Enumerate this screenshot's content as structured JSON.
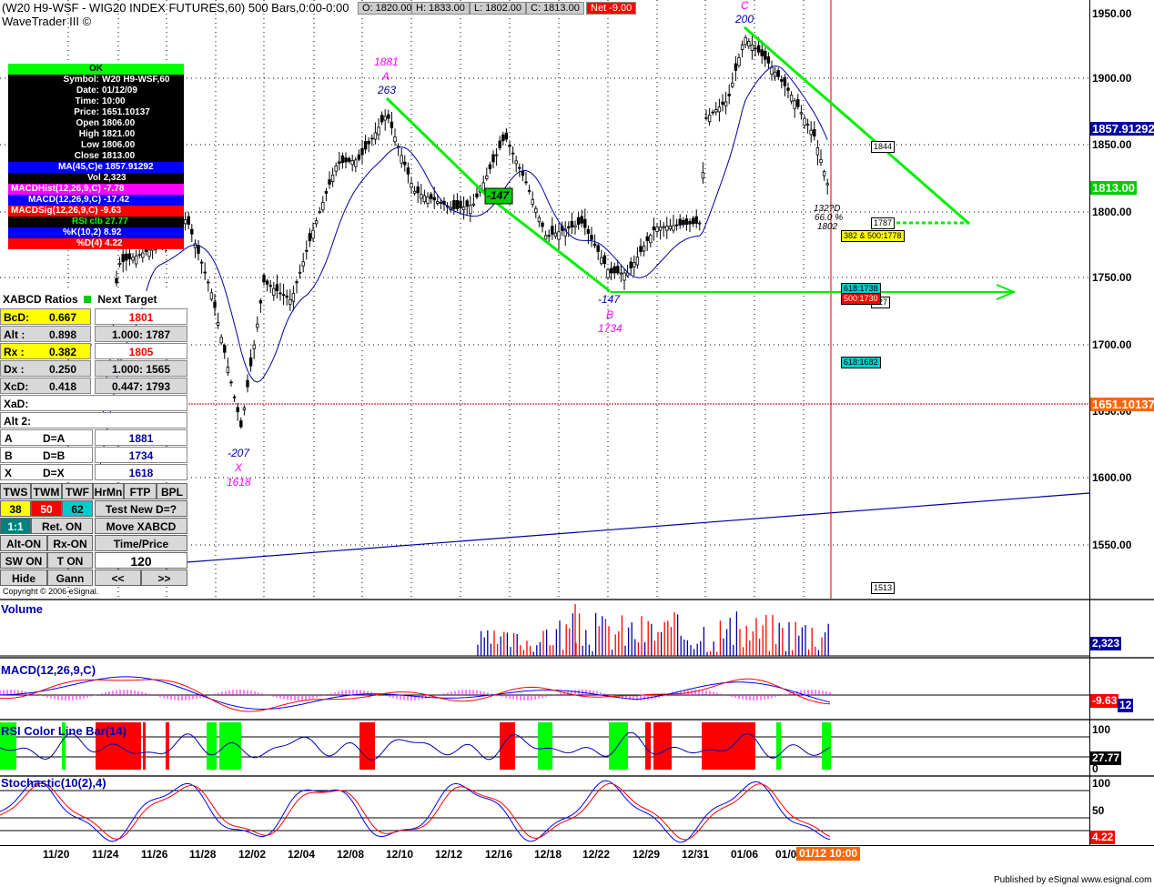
{
  "header": {
    "title_line1": "(W20 H9-WSF - WIG20 INDEX FUTURES,60) 500 Bars,0:00-0:00",
    "title_line2": "WaveTrader III ©",
    "open": "O: 1820.00",
    "high": "H: 1833.00",
    "low": "L: 1802.00",
    "close": "C: 1813.00",
    "net": "Net -9.00"
  },
  "info_panel": {
    "status": "OK",
    "rows": [
      {
        "k": "Symbol:",
        "v": "W20 H9-WSF,60"
      },
      {
        "k": "Date:",
        "v": "01/12/09"
      },
      {
        "k": "Time:",
        "v": "10:00"
      },
      {
        "k": "Price:",
        "v": "1651.10137"
      },
      {
        "k": "Open",
        "v": "1806.00"
      },
      {
        "k": "High",
        "v": "1821.00"
      },
      {
        "k": "Low",
        "v": "1806.00"
      },
      {
        "k": "Close",
        "v": "1813.00"
      }
    ],
    "ma": "MA(45,C)e  1857.91292",
    "vol": "Vol  2,323",
    "macdhist": "MACDHist(12,26,9,C) -7.78",
    "macd": "MACD(12,26,9,C) -17.42",
    "macdsig": "MACDSig(12,26,9,C) -9.63",
    "rsi": "RSI clb  27.77",
    "k": "%K(10,2)  8.92",
    "d": "%D(4)  4.22"
  },
  "xabcd": {
    "title": "XABCD Ratios",
    "next_target": "Next Target",
    "rows": [
      {
        "label": "BcD:",
        "val": "0.667",
        "target": "1801"
      },
      {
        "label": "Alt  :",
        "val": "0.898",
        "target": "1.000: 1787"
      },
      {
        "label": "Rx   :",
        "val": "0.382",
        "target": "1805"
      },
      {
        "label": "Dx   :",
        "val": "0.250",
        "target": "1.000: 1565"
      },
      {
        "label": "XcD:",
        "val": "0.418",
        "target": "0.447: 1793"
      }
    ],
    "xad": "XaD:",
    "alt2": "Alt 2:",
    "eq_rows": [
      {
        "label": "A",
        "eq": "D=A",
        "val": "1881"
      },
      {
        "label": "B",
        "eq": "D=B",
        "val": "1734"
      },
      {
        "label": "X",
        "eq": "D=X",
        "val": "1618"
      }
    ],
    "buttons_row1": [
      "TWS",
      "TWM",
      "TWF",
      "HrMn",
      "FTP",
      "BPL"
    ],
    "num1": "38",
    "num2": "50",
    "num3": "62",
    "test_new": "Test New D=?",
    "ratio": "1:1",
    "ret_on": "Ret. ON",
    "move_xabcd": "Move XABCD",
    "alt_on": "Alt-ON",
    "rx_on": "Rx-ON",
    "time_price": "Time/Price",
    "sw_on": "SW ON",
    "t_on": "T ON",
    "bars": "120",
    "hide": "Hide",
    "gann": "Gann",
    "prev": "<<",
    "next": ">>"
  },
  "pattern_labels": {
    "x_bars": "-207",
    "x_name": "X",
    "x_price": "1618",
    "a_price": "1881",
    "a_name": "A",
    "a_bars": "263",
    "b_bars": "-147",
    "b_name": "B",
    "b_price": "1734",
    "c_name": "C",
    "c_bars": "200",
    "d_ratio": "132?D",
    "d_pct": "66.0 %",
    "d_price": "1802",
    "mid_bars": "-147"
  },
  "target_boxes": {
    "t1844": "1844",
    "t1787": "1787",
    "t382": "382 & 500:1778",
    "t618": "618:1738",
    "t500": "500:1730",
    "t727": "727",
    "t618b": "618:1682",
    "t1513": "1513"
  },
  "price_axis": {
    "ticks": [
      "1950.00",
      "1900.00",
      "1850.00",
      "1800.00",
      "1750.00",
      "1700.00",
      "1650.00",
      "1600.00",
      "1550.00"
    ],
    "ma_tag": "1857.91292",
    "close_tag": "1813.00",
    "cursor_tag": "1651.10137"
  },
  "volume": {
    "title": "Volume",
    "tag": "2,323"
  },
  "macd_pane": {
    "title": "MACD(12,26,9,C)",
    "tag": "-9.63",
    "tag2": "12"
  },
  "rsi_pane": {
    "title": "RSI Color Line Bar(14)",
    "tick100": "100",
    "tick0": "0",
    "tag": "27.77"
  },
  "stoch_pane": {
    "title": "Stochastic(10(2),4)",
    "tick100": "100",
    "tick50": "50",
    "tag": "4.22"
  },
  "dates": [
    "11/20",
    "11/24",
    "11/26",
    "11/28",
    "12/02",
    "12/04",
    "12/08",
    "12/10",
    "12/12",
    "12/16",
    "12/18",
    "12/22",
    "12/29",
    "12/31",
    "01/06",
    "01/0"
  ],
  "cursor_date": "01/12 10:00",
  "copyright": "Copyright © 2006 eSignal.",
  "published": "Published by eSignal    www.esignal.com",
  "colors": {
    "green": "#00ff00",
    "magenta": "#ff00ff",
    "navy": "#0000a0",
    "red": "#ff0000"
  }
}
